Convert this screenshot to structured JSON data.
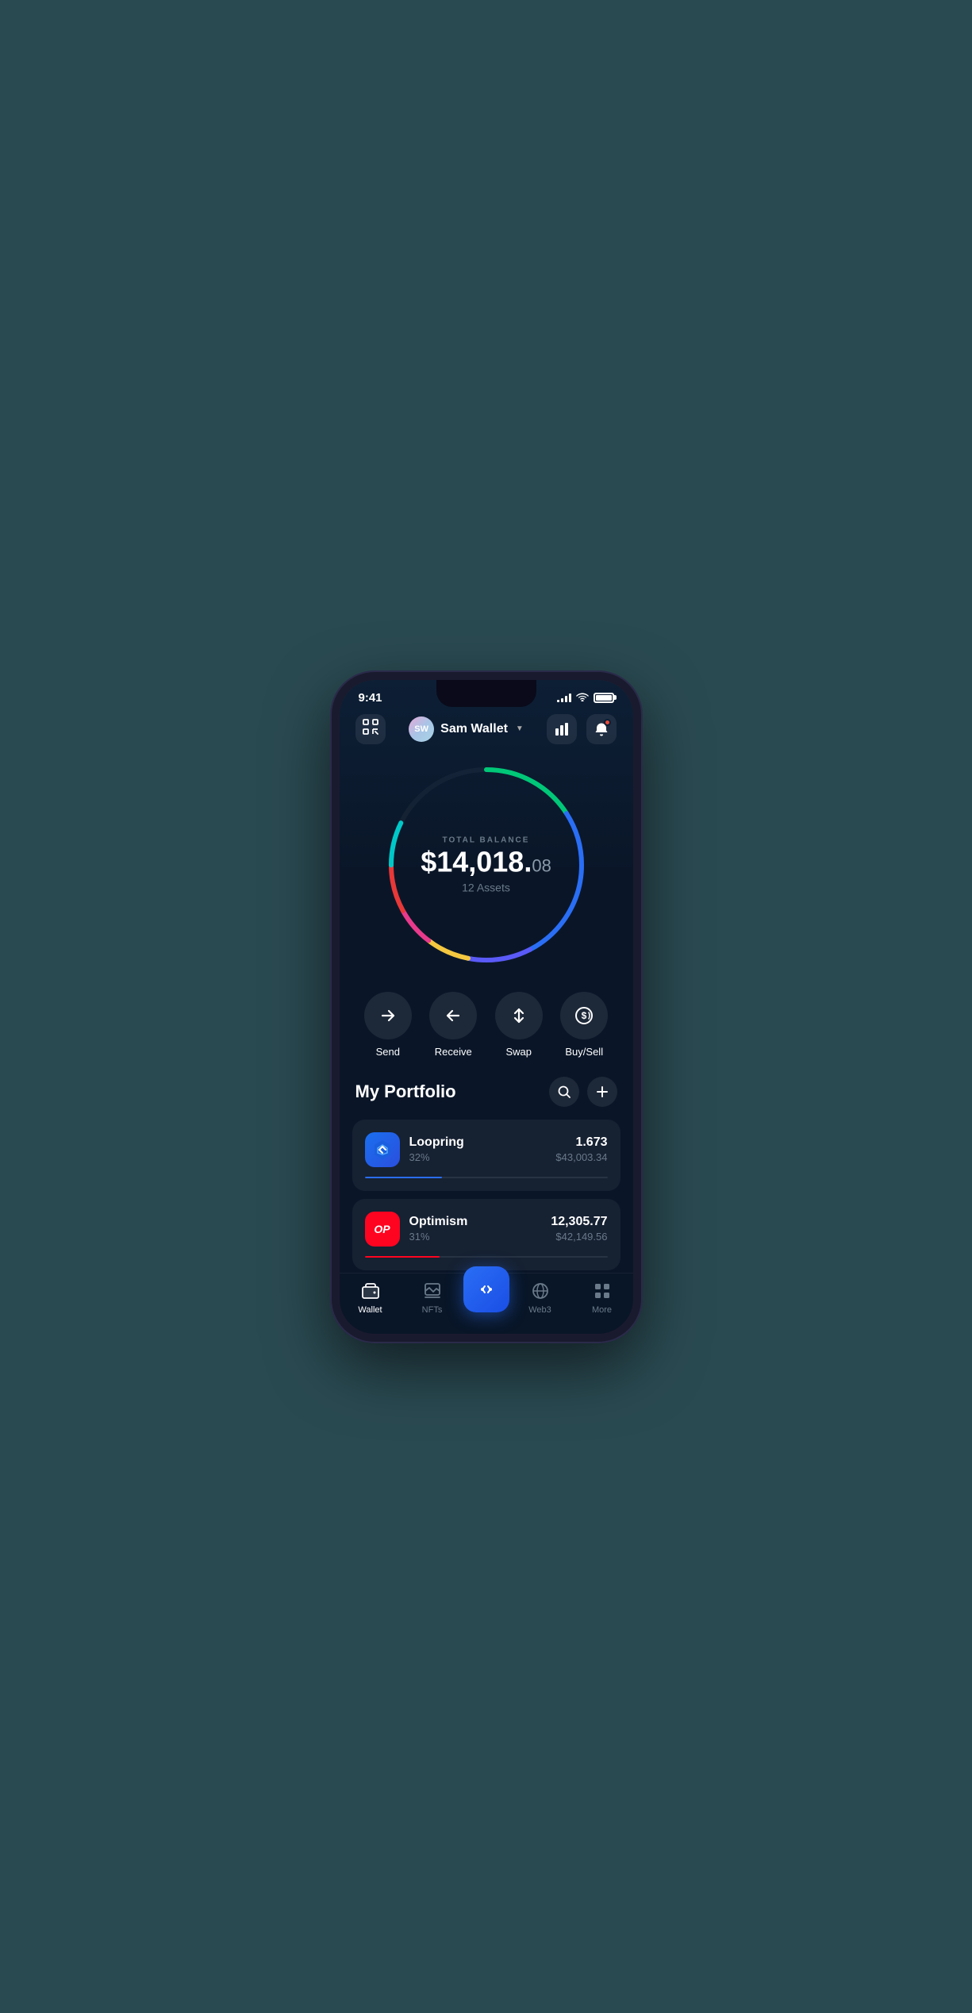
{
  "status": {
    "time": "9:41",
    "signal_bars": [
      3,
      6,
      9,
      12
    ],
    "battery_level": "100%"
  },
  "header": {
    "scan_icon_label": "scan",
    "avatar_initials": "SW",
    "wallet_name": "Sam Wallet",
    "chart_icon_label": "chart",
    "notification_icon_label": "notification"
  },
  "balance": {
    "label": "TOTAL BALANCE",
    "amount_main": "$14,018.",
    "amount_cents": "08",
    "assets_count": "12 Assets"
  },
  "actions": [
    {
      "id": "send",
      "label": "Send",
      "icon": "→"
    },
    {
      "id": "receive",
      "label": "Receive",
      "icon": "←"
    },
    {
      "id": "swap",
      "label": "Swap",
      "icon": "⇅"
    },
    {
      "id": "buysell",
      "label": "Buy/Sell",
      "icon": "💲"
    }
  ],
  "portfolio": {
    "title": "My Portfolio",
    "search_label": "search",
    "add_label": "add",
    "assets": [
      {
        "id": "loopring",
        "name": "Loopring",
        "pct": "32%",
        "amount": "1.673",
        "usd": "$43,003.34",
        "progress": 32,
        "color": "#2a6ef5"
      },
      {
        "id": "optimism",
        "name": "Optimism",
        "pct": "31%",
        "amount": "12,305.77",
        "usd": "$42,149.56",
        "progress": 31,
        "color": "#ff0420"
      }
    ]
  },
  "nav": {
    "items": [
      {
        "id": "wallet",
        "label": "Wallet",
        "active": true
      },
      {
        "id": "nfts",
        "label": "NFTs",
        "active": false
      },
      {
        "id": "swap_center",
        "label": "",
        "active": false,
        "is_center": true
      },
      {
        "id": "web3",
        "label": "Web3",
        "active": false
      },
      {
        "id": "more",
        "label": "More",
        "active": false
      }
    ]
  },
  "circle": {
    "segments": [
      {
        "color": "#00c8a0",
        "dash": 60,
        "offset": 0
      },
      {
        "color": "#4a90f5",
        "dash": 110,
        "offset": 60
      },
      {
        "color": "#4a4af5",
        "dash": 60,
        "offset": 170
      },
      {
        "color": "#f5c842",
        "dash": 40,
        "offset": 230
      },
      {
        "color": "#e83a8c",
        "dash": 35,
        "offset": 270
      },
      {
        "color": "#e83838",
        "dash": 40,
        "offset": 305
      },
      {
        "color": "#00c8c8",
        "dash": 35,
        "offset": 345
      }
    ]
  }
}
